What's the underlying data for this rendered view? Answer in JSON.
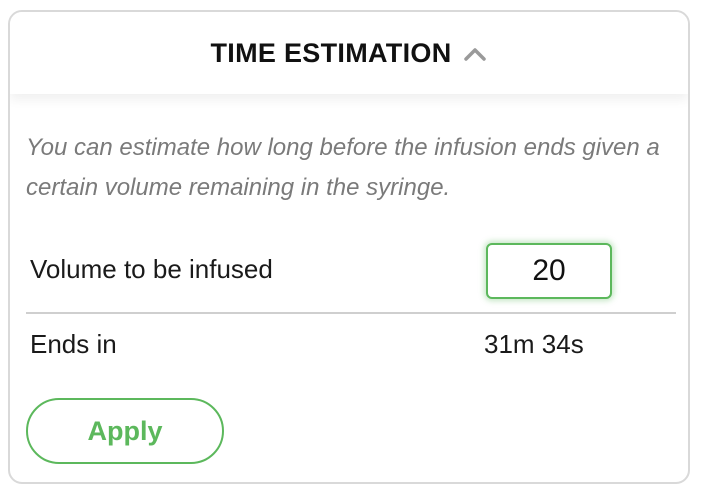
{
  "header": {
    "title": "TIME ESTIMATION",
    "toggle_icon": "chevron-up-icon"
  },
  "description": "You can estimate how long before the infusion ends given a certain volume remaining in the syringe.",
  "volume": {
    "label": "Volume to be infused",
    "value": "20"
  },
  "ends_in": {
    "label": "Ends in",
    "value": "31m 34s"
  },
  "apply_button": {
    "label": "Apply"
  },
  "colors": {
    "accent": "#5cb85c",
    "description_text": "#7a7a7a",
    "border": "#d9d9d9"
  }
}
